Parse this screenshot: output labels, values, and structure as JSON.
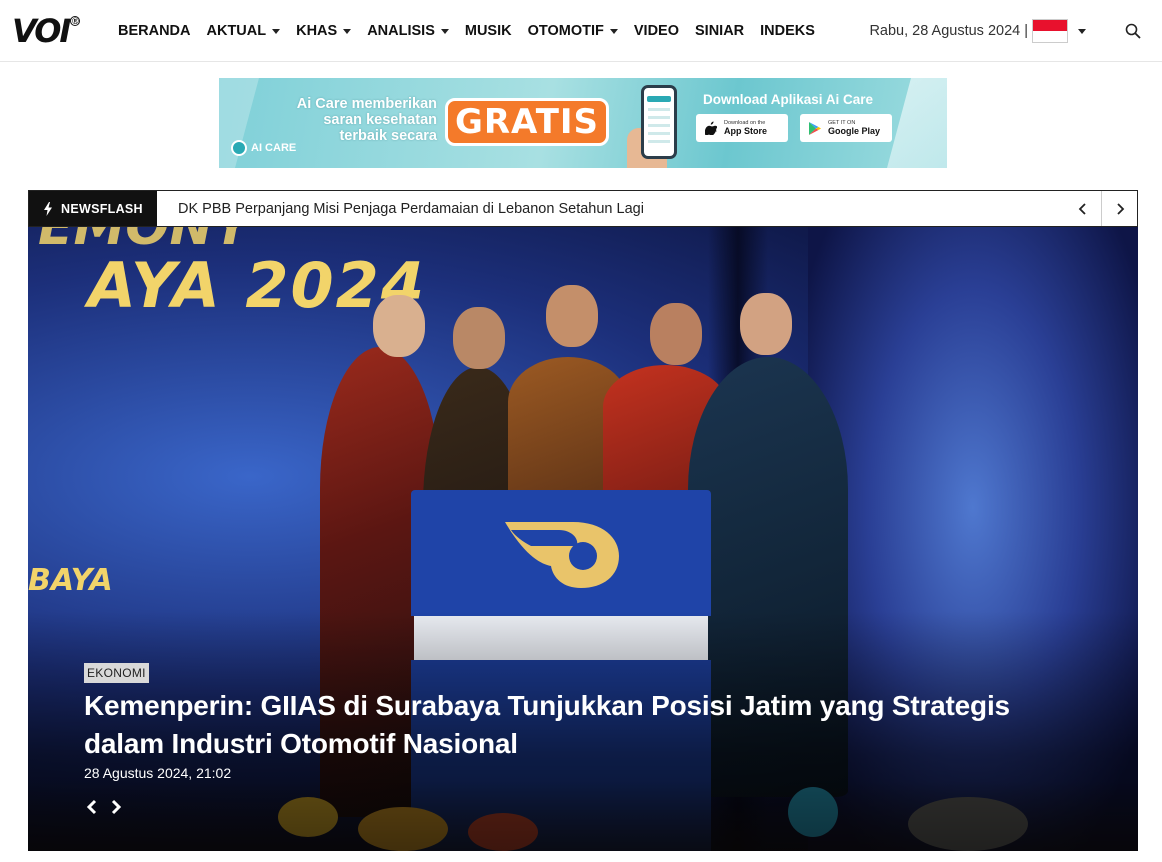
{
  "header": {
    "logo_text": "VOI",
    "logo_mark": "®",
    "nav": [
      {
        "label": "BERANDA",
        "dropdown": false
      },
      {
        "label": "AKTUAL",
        "dropdown": true
      },
      {
        "label": "KHAS",
        "dropdown": true
      },
      {
        "label": "ANALISIS",
        "dropdown": true
      },
      {
        "label": "MUSIK",
        "dropdown": false
      },
      {
        "label": "OTOMOTIF",
        "dropdown": true
      },
      {
        "label": "VIDEO",
        "dropdown": false
      },
      {
        "label": "SINIAR",
        "dropdown": false
      },
      {
        "label": "INDEKS",
        "dropdown": false
      }
    ],
    "date": "Rabu, 28 Agustus 2024",
    "separator": "|",
    "language_flag": "indonesia-flag-icon",
    "search_icon": "search-icon"
  },
  "ad": {
    "left_text_1": "Ai Care memberikan",
    "left_text_2": "saran kesehatan",
    "left_text_3": "terbaik secara",
    "badge": "GRATIS",
    "brand": "AI CARE",
    "right_title": "Download Aplikasi Ai Care",
    "app_store_small": "Download on the",
    "app_store_big": "App Store",
    "google_play_small": "GET IT ON",
    "google_play_big": "Google Play"
  },
  "newsflash": {
    "label": "NEWSFLASH",
    "text": "DK PBB Perpanjang Misi Penjaga Perdamaian di Lebanon Setahun Lagi"
  },
  "hero": {
    "wall_text_top": "EMONY",
    "wall_text_main": "AYA 2024",
    "wall_text_side": "BAYA",
    "category": "EKONOMI",
    "headline": "Kemenperin: GIIAS di Surabaya Tunjukkan Posisi Jatim yang Strategis dalam Industri Otomotif Nasional",
    "date": "28 Agustus 2024, 21:02"
  },
  "colors": {
    "accent": "#111111",
    "flag_red": "#e8112d",
    "ad_orange": "#f47a2a",
    "ad_teal": "#7fd0d8"
  }
}
